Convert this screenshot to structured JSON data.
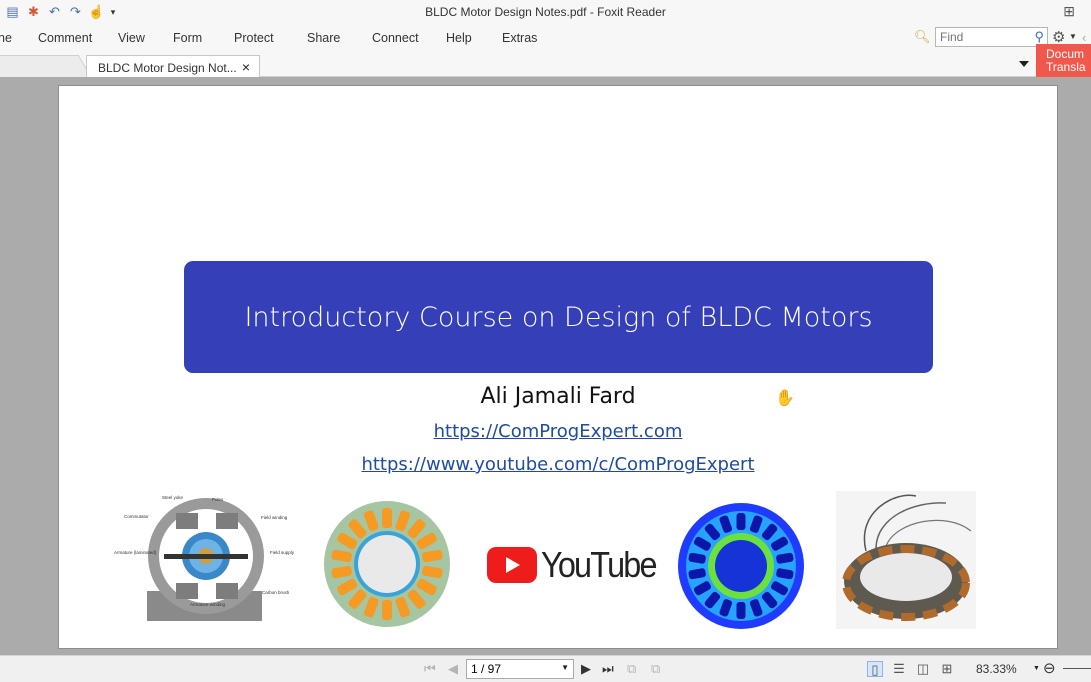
{
  "window": {
    "title": "BLDC Motor Design Notes.pdf - Foxit Reader"
  },
  "quick_access": [
    {
      "icon": "file-icon",
      "glyph": "▤"
    },
    {
      "icon": "new-document-icon",
      "glyph": "✱"
    },
    {
      "icon": "undo-icon",
      "glyph": "↶"
    },
    {
      "icon": "redo-icon",
      "glyph": "↷"
    },
    {
      "icon": "hand-tool-icon",
      "glyph": "☝"
    },
    {
      "icon": "customize-caret-icon",
      "glyph": "▾"
    }
  ],
  "menu": {
    "items": [
      "ne",
      "Comment",
      "View",
      "Form",
      "Protect",
      "Share",
      "Connect",
      "Help",
      "Extras"
    ]
  },
  "search": {
    "placeholder": "Find"
  },
  "tabs": {
    "active_label": "BLDC Motor Design Not...",
    "close_glyph": "×"
  },
  "doc_translate": {
    "line1": "Docum",
    "line2": "Transla"
  },
  "slide": {
    "title": "Introductory Course on Design of BLDC Motors",
    "author": "Ali Jamali Fard",
    "link1": "https://ComProgExpert.com",
    "link2": "https://www.youtube.com/c/ComProgExpert",
    "youtube_text": "YouTube",
    "motor_diagram_labels": {
      "steel_yoke": "Steel yoke",
      "poles": "Poles",
      "commutator": "Commutator",
      "field_winding": "Field winding",
      "armature": "Armature (laminated)",
      "field_supply": "Field supply",
      "carbon_brush": "Carbon brush",
      "armature_winding": "Armature winding"
    }
  },
  "status": {
    "page_value": "1 / 97",
    "zoom": "83.33%"
  },
  "colors": {
    "banner": "#3540b8",
    "link": "#1f4aa8",
    "translate_button": "#f2574c",
    "youtube_red": "#ee1c1b"
  }
}
